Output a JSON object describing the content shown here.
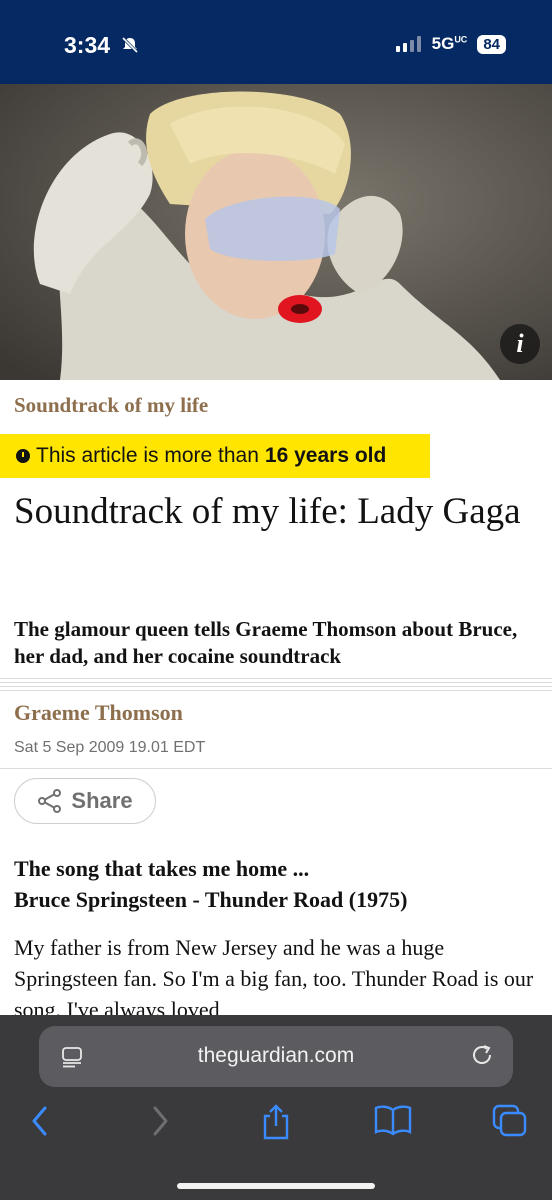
{
  "status_bar": {
    "time": "3:34",
    "network": "5G",
    "network_sup": "UC",
    "battery": "84"
  },
  "hero": {
    "info_label": "i"
  },
  "article": {
    "kicker": "Soundtrack of my life",
    "age_notice_prefix": "This article is more than",
    "age_notice_bold": "16 years old",
    "headline": "Soundtrack of my life: Lady Gaga",
    "standfirst": "The glamour queen tells Graeme Thomson about Bruce, her dad, and her cocaine soundtrack",
    "byline": "Graeme Thomson",
    "date": "Sat 5 Sep 2009 19.01 EDT",
    "share_label": "Share",
    "subheading_line1": "The song that takes me home ...",
    "subheading_line2": "Bruce Springsteen - Thunder Road (1975)",
    "body_paragraph": "My father is from New Jersey and he was a huge Springsteen fan. So I'm a big fan, too. Thunder Road is our song. I've always loved"
  },
  "browser": {
    "url": "theguardian.com"
  },
  "colors": {
    "guardian_blue": "#052962",
    "kicker_brown": "#8d6e4d",
    "age_yellow": "#ffe500",
    "safari_blue": "#3a8bff"
  }
}
